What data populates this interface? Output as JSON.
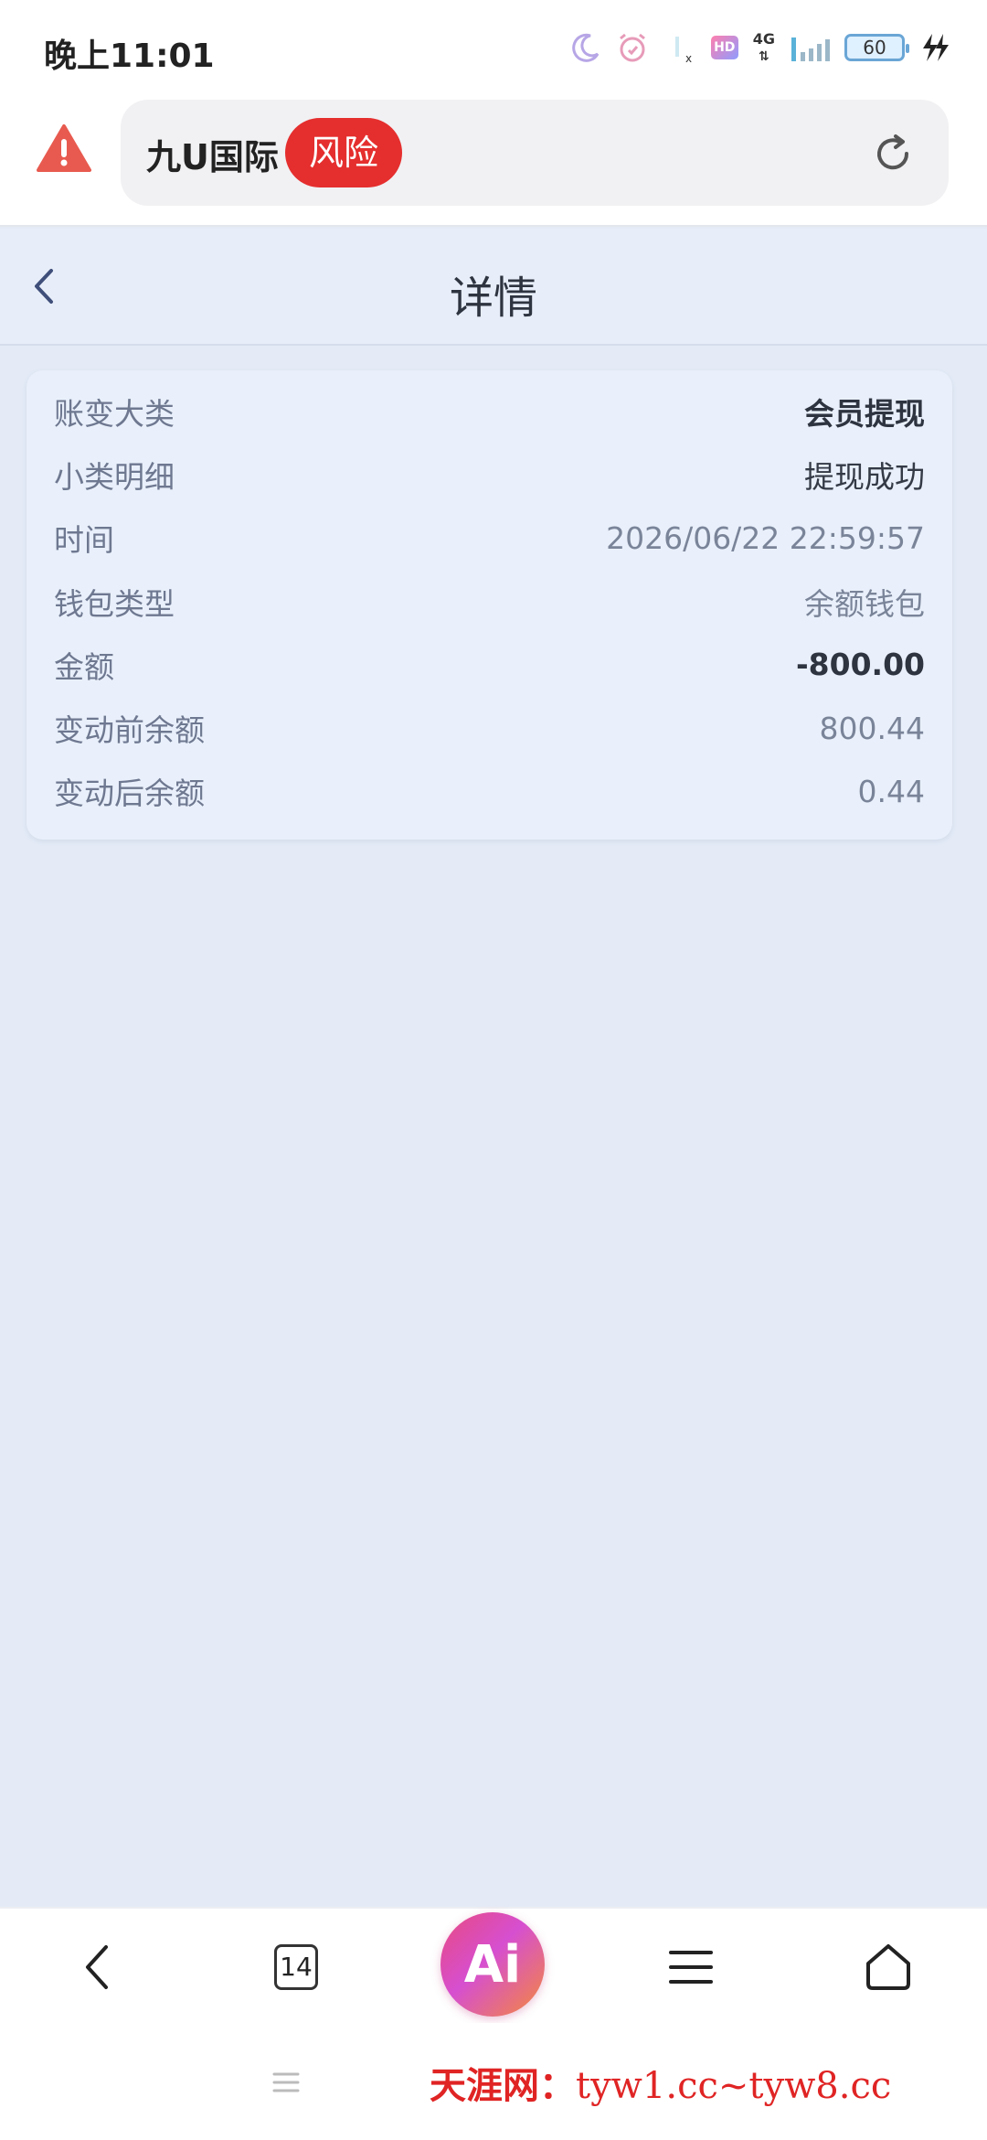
{
  "status_bar": {
    "time": "晚上11:01",
    "network": "4G",
    "hd": "HD",
    "battery": "60",
    "icons": [
      "moon-icon",
      "alarm-icon",
      "wifi-icon",
      "hd-icon",
      "network-4g-icon",
      "signal-icon",
      "battery-icon",
      "charging-icon"
    ]
  },
  "browser": {
    "site_name": "九U国际",
    "risk_label": "风险",
    "warning_color": "#e52e2e"
  },
  "page": {
    "title": "详情"
  },
  "details": [
    {
      "label": "账变大类",
      "value": "会员提现"
    },
    {
      "label": "小类明细",
      "value": "提现成功"
    },
    {
      "label": "时间",
      "value": "2026/06/22 22:59:57"
    },
    {
      "label": "钱包类型",
      "value": "余额钱包"
    },
    {
      "label": "金额",
      "value": "-800.00"
    },
    {
      "label": "变动前余额",
      "value": "800.44"
    },
    {
      "label": "变动后余额",
      "value": "0.44"
    }
  ],
  "bottom_nav": {
    "tab_count": "14",
    "ai_label": "Ai"
  },
  "watermark": {
    "cn": "天涯网：",
    "url": "tyw1.cc~tyw8.cc"
  }
}
